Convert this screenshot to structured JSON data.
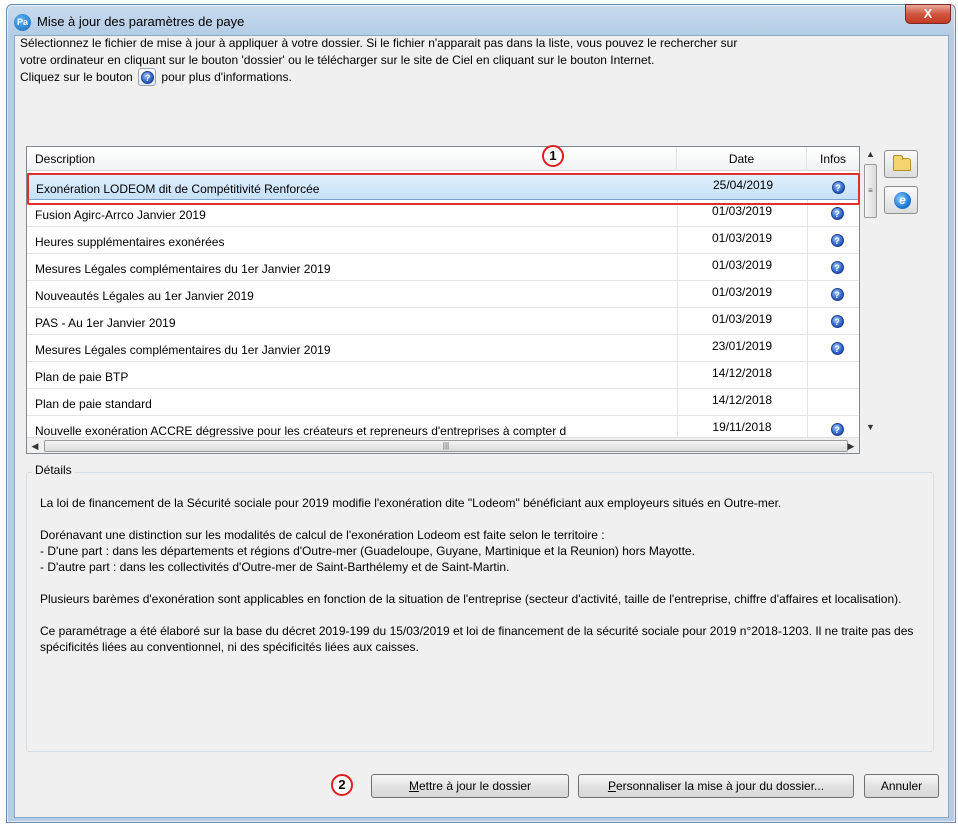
{
  "window": {
    "app_icon": "Pa",
    "title": "Mise à jour des paramètres de paye",
    "close_label": "X"
  },
  "intro": {
    "line1": "Sélectionnez le fichier de mise à jour à appliquer à votre dossier. Si le fichier n'apparait pas dans la liste, vous pouvez le rechercher sur",
    "line2": "votre ordinateur en cliquant sur le bouton 'dossier' ou le télécharger sur le site de Ciel en cliquant sur le bouton Internet.",
    "line3_before": "Cliquez sur le bouton",
    "line3_after": "pour plus d'informations."
  },
  "table": {
    "columns": [
      "Description",
      "Date",
      "Infos"
    ],
    "rows": [
      {
        "description": "Exonération LODEOM dit de Compétitivité Renforcée",
        "date": "25/04/2019",
        "info": true,
        "selected": true
      },
      {
        "description": "Fusion Agirc-Arrco Janvier 2019",
        "date": "01/03/2019",
        "info": true
      },
      {
        "description": "Heures supplémentaires exonérées",
        "date": "01/03/2019",
        "info": true
      },
      {
        "description": "Mesures Légales complémentaires du 1er Janvier 2019",
        "date": "01/03/2019",
        "info": true
      },
      {
        "description": "Nouveautés Légales au 1er Janvier 2019",
        "date": "01/03/2019",
        "info": true
      },
      {
        "description": "PAS - Au 1er Janvier 2019",
        "date": "01/03/2019",
        "info": true
      },
      {
        "description": "Mesures Légales complémentaires du 1er Janvier 2019",
        "date": "23/01/2019",
        "info": true
      },
      {
        "description": "Plan de paie BTP",
        "date": "14/12/2018",
        "info": false
      },
      {
        "description": "Plan de paie standard",
        "date": "14/12/2018",
        "info": false
      },
      {
        "description": "Nouvelle exonération ACCRE dégressive pour les créateurs et repreneurs d'entreprises à compter d",
        "date": "19/11/2018",
        "info": true
      }
    ],
    "info_icon": "?"
  },
  "markers": {
    "one": "1",
    "two": "2"
  },
  "details": {
    "legend": "Détails",
    "p1": "La loi de financement de la Sécurité sociale pour 2019 modifie l'exonération dite \"Lodeom\" bénéficiant aux employeurs situés en Outre-mer.",
    "p2a": "Dorénavant une distinction sur les modalités de calcul de l'exonération Lodeom est faite selon le territoire :",
    "p2b": "- D'une part : dans les départements et régions d'Outre-mer (Guadeloupe, Guyane, Martinique et la Reunion) hors Mayotte.",
    "p2c": "- D'autre part : dans les collectivités d'Outre-mer de Saint-Barthélemy et de Saint-Martin.",
    "p3": "Plusieurs barèmes d'exonération sont applicables en fonction de la situation de l'entreprise (secteur d'activité, taille de l'entreprise, chiffre d'affaires et localisation).",
    "p4": "Ce paramétrage a été élaboré sur la base du décret 2019-199 du 15/03/2019 et loi de financement de la sécurité sociale pour 2019 n°2018-1203. Il ne traite pas des spécificités liées au conventionnel, ni des spécificités liées aux caisses."
  },
  "buttons": {
    "update_first": "M",
    "update_rest": "ettre à jour le dossier",
    "customize_first": "P",
    "customize_rest": "ersonnaliser la mise à jour du dossier...",
    "cancel": "Annuler"
  },
  "icons": {
    "folder": "folder-icon",
    "internet": "internet-explorer-icon",
    "help": "help-icon"
  },
  "colors": {
    "highlight": "#e0302a",
    "selection": "#c6e1f8",
    "title_bar": "#b4cce6"
  }
}
